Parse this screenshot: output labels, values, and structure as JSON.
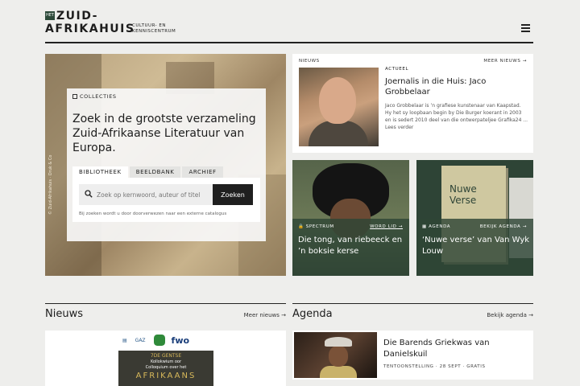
{
  "header": {
    "logo_het": "HET",
    "logo_line1": "ZUID-",
    "logo_line2": "AFRIKAHUIS",
    "logo_sub1": "CULTUUR- EN",
    "logo_sub2": "KENNISCENTRUM"
  },
  "hero": {
    "section_label": "COLLECTIES",
    "title": "Zoek in de grootste verzameling Zuid-Afrikaanse Literatuur van Europa.",
    "photo_caption": "© Zuid-Afrikahuis · Druk & Co",
    "tabs": [
      {
        "label": "BIBLIOTHEEK"
      },
      {
        "label": "BEELDBANK"
      },
      {
        "label": "ARCHIEF"
      }
    ],
    "search_placeholder": "Zoek op kernwoord, auteur of titel",
    "search_button": "Zoeken",
    "search_note": "Bij zoeken wordt u door doorverwezen naar een externe catalogus"
  },
  "featured_news": {
    "section_label": "NIEUWS",
    "more_label": "MEER NIEUWS",
    "category": "ACTUEEL",
    "title": "Joernalis in die Huis: Jaco Grobbelaar",
    "excerpt": "Jaco Grobbelaar is ’n grafiese kunstenaar van Kaapstad. Hy het sy loopbaan begin by Die Burger koerant in 2003 en is sedert 2010 deel van die ontwerpateljee Grafika24 ...",
    "read_more": "Lees verder"
  },
  "tiles": [
    {
      "label": "SPECTRUM",
      "link": "WORD LID",
      "title": "Die tong, van riebeeck en ’n boksie kerse"
    },
    {
      "label": "AGENDA",
      "link": "BEKIJK AGENDA",
      "title": "‘Nuwe verse’ van Van Wyk Louw",
      "book_title": "Nuwe Verse"
    }
  ],
  "sections": {
    "nieuws_title": "Nieuws",
    "nieuws_more": "Meer nieuws",
    "agenda_title": "Agenda",
    "agenda_more": "Bekijk agenda"
  },
  "news_bottom": {
    "logo_fwo": "fwo",
    "logo_gaz": "GAZ",
    "poster_line1": "7DE GENTSE",
    "poster_line2": "Kollokwium oor",
    "poster_line3": "Colloquium over het",
    "poster_line4": "AFRIKAANS"
  },
  "agenda_item": {
    "title": "Die Barends Griekwas van Danielskuil",
    "category": "TENTOONSTELLING",
    "date": "28 SEPT",
    "price": "GRATIS"
  },
  "colors": {
    "accent_green": "#2e4436",
    "background": "#eeeeec"
  }
}
